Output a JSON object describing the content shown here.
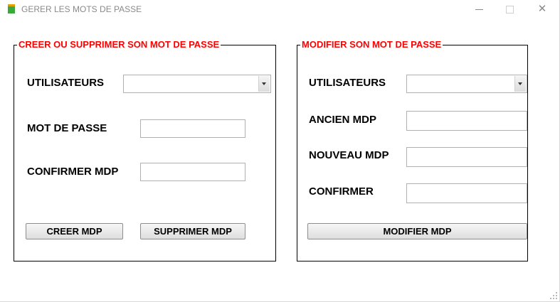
{
  "window": {
    "title": "GERER LES MOTS DE PASSE",
    "icon": "app-icon",
    "controls": {
      "minimize": "minimize-icon",
      "maximize": "maximize-icon",
      "close": "✕"
    }
  },
  "left_group": {
    "title": "CREER OU SUPPRIMER SON MOT DE PASSE",
    "users_label": "UTILISATEURS",
    "users_value": "",
    "password_label": "MOT DE PASSE",
    "password_value": "",
    "confirm_label": "CONFIRMER MDP",
    "confirm_value": "",
    "create_button": "CREER MDP",
    "delete_button": "SUPPRIMER MDP"
  },
  "right_group": {
    "title": "MODIFIER SON MOT DE PASSE",
    "users_label": "UTILISATEURS",
    "users_value": "",
    "old_label": "ANCIEN MDP",
    "old_value": "",
    "new_label": "NOUVEAU MDP",
    "new_value": "",
    "confirm_label": "CONFIRMER",
    "confirm_value": "",
    "modify_button": "MODIFIER MDP"
  },
  "colors": {
    "group_title": "#ff0000",
    "border": "#000000",
    "title_text": "#8a8a8a"
  }
}
